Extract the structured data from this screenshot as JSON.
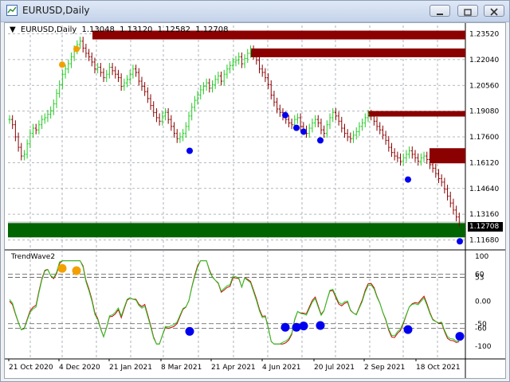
{
  "window": {
    "title": "EURUSD,Daily"
  },
  "chart": {
    "symbol_label": "EURUSD,Daily",
    "ohlc": [
      "1.13048",
      "1.13120",
      "1.12582",
      "1.12708"
    ],
    "current_price": "1.12708",
    "price_ticks": [
      "1.23520",
      "1.22040",
      "1.20560",
      "1.19080",
      "1.17600",
      "1.16120",
      "1.14640",
      "1.13160",
      "1.11680"
    ],
    "indicator_name": "TrendWave2",
    "indicator_ticks": [
      "100",
      "60",
      "53",
      "0.00",
      "-50",
      "-60",
      "-100"
    ],
    "date_labels": [
      "21 Oct 2020",
      "4 Dec 2020",
      "21 Jan 2021",
      "8 Mar 2021",
      "21 Apr 2021",
      "4 Jun 2021",
      "20 Jul 2021",
      "2 Sep 2021",
      "18 Oct 2021"
    ],
    "colors": {
      "bull": "#22cc22",
      "bear": "#8b0000",
      "supply_zone": "#8b0000",
      "demand_zone": "#006400",
      "signal_up": "#f2a000",
      "signal_down": "#0000ee",
      "wave_fast": "#22cc22",
      "wave_slow": "#cc0000"
    }
  },
  "chart_data": {
    "type": "line",
    "title": "EURUSD,Daily",
    "ylim": [
      1.112,
      1.24
    ],
    "price_close_series": [
      1.186,
      1.183,
      1.176,
      1.17,
      1.165,
      1.166,
      1.172,
      1.178,
      1.181,
      1.18,
      1.183,
      1.186,
      1.187,
      1.189,
      1.191,
      1.195,
      1.201,
      1.206,
      1.212,
      1.215,
      1.218,
      1.222,
      1.226,
      1.229,
      1.231,
      1.227,
      1.224,
      1.222,
      1.219,
      1.215,
      1.216,
      1.213,
      1.21,
      1.212,
      1.216,
      1.214,
      1.212,
      1.21,
      1.205,
      1.207,
      1.209,
      1.212,
      1.215,
      1.213,
      1.208,
      1.205,
      1.202,
      1.198,
      1.194,
      1.19,
      1.187,
      1.185,
      1.188,
      1.19,
      1.186,
      1.182,
      1.178,
      1.175,
      1.176,
      1.178,
      1.182,
      1.188,
      1.193,
      1.197,
      1.2,
      1.203,
      1.205,
      1.207,
      1.204,
      1.206,
      1.209,
      1.211,
      1.208,
      1.212,
      1.215,
      1.217,
      1.219,
      1.22,
      1.222,
      1.218,
      1.221,
      1.224,
      1.226,
      1.223,
      1.22,
      1.215,
      1.213,
      1.21,
      1.206,
      1.2,
      1.196,
      1.192,
      1.19,
      1.188,
      1.186,
      1.184,
      1.183,
      1.186,
      1.187,
      1.182,
      1.18,
      1.178,
      1.181,
      1.184,
      1.186,
      1.184,
      1.18,
      1.178,
      1.183,
      1.187,
      1.19,
      1.188,
      1.185,
      1.181,
      1.178,
      1.176,
      1.175,
      1.177,
      1.179,
      1.182,
      1.184,
      1.187,
      1.189,
      1.188,
      1.185,
      1.182,
      1.18,
      1.177,
      1.174,
      1.17,
      1.167,
      1.165,
      1.164,
      1.162,
      1.164,
      1.166,
      1.168,
      1.166,
      1.164,
      1.162,
      1.164,
      1.165,
      1.163,
      1.16,
      1.158,
      1.155,
      1.152,
      1.15,
      1.146,
      1.142,
      1.138,
      1.134,
      1.13,
      1.127
    ]
  }
}
